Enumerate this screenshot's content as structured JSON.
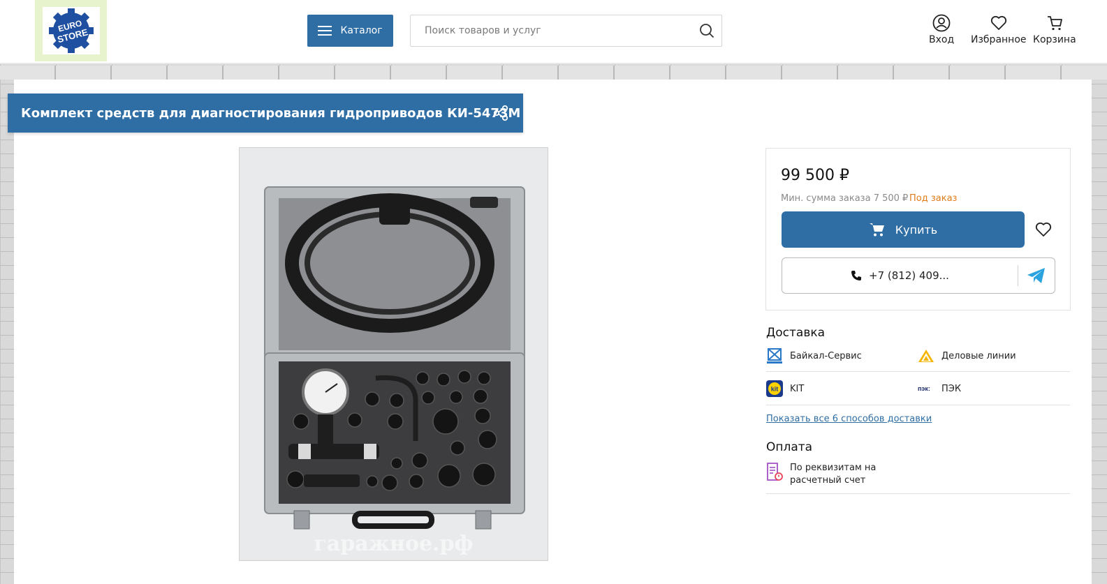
{
  "header": {
    "logo_line1": "EURO",
    "logo_line2": "STORE",
    "catalog_label": "Каталог",
    "search_placeholder": "Поиск товаров и услуг",
    "login_label": "Вход",
    "favorites_label": "Избранное",
    "cart_label": "Корзина"
  },
  "product": {
    "title": "Комплект средств для диагностирования гидроприводов КИ-5473М",
    "watermark": "гаражное.рф"
  },
  "purchase": {
    "price": "99 500 ₽",
    "min_order": "Мин. сумма заказа 7 500 ₽",
    "status": "Под заказ",
    "buy_label": "Купить",
    "phone": "+7 (812) 409..."
  },
  "delivery": {
    "title": "Доставка",
    "items": [
      "Байкал-Сервис",
      "Деловые линии",
      "KIT",
      "ПЭК"
    ],
    "pek_logo_text": "пэк:",
    "kit_logo_text": "kit",
    "show_all": "Показать все 6 способов доставки"
  },
  "payment": {
    "title": "Оплата",
    "method": "По реквизитам на расчетный счет"
  },
  "colors": {
    "primary": "#2f6ea5",
    "status": "#e07b18",
    "telegram": "#2aa3df"
  }
}
